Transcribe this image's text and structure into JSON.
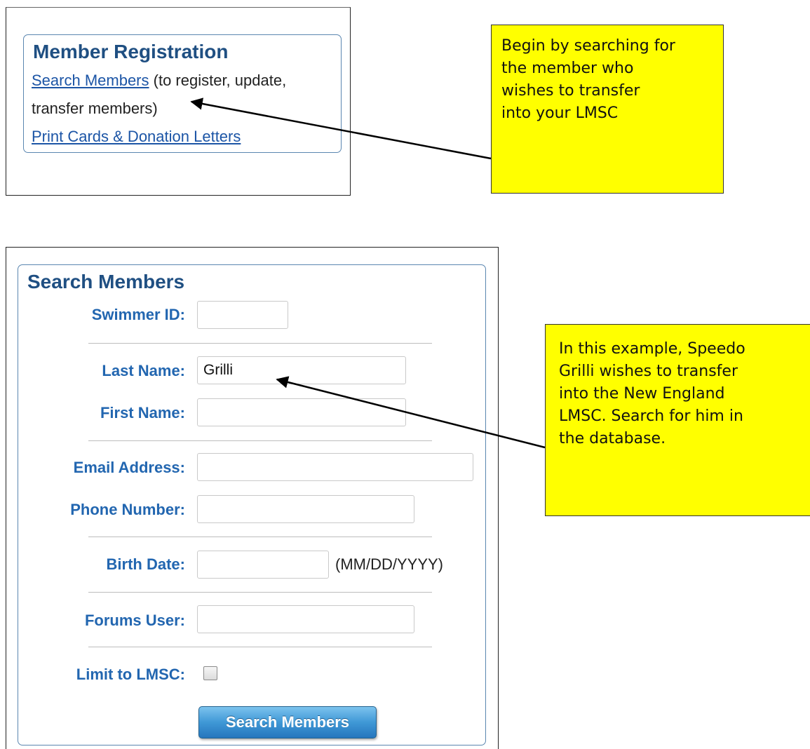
{
  "member_registration": {
    "title": "Member Registration",
    "search_link": "Search Members",
    "search_suffix_1": " (to register, update,",
    "search_suffix_2": "transfer members)",
    "print_link": "Print Cards & Donation Letters"
  },
  "search_form": {
    "title": "Search Members",
    "swimmer_id": {
      "label": "Swimmer ID:",
      "value": ""
    },
    "last_name": {
      "label": "Last Name:",
      "value": "Grilli"
    },
    "first_name": {
      "label": "First Name:",
      "value": ""
    },
    "email": {
      "label": "Email Address:",
      "value": ""
    },
    "phone": {
      "label": "Phone Number:",
      "value": ""
    },
    "birth_date": {
      "label": "Birth Date:",
      "value": "",
      "hint": "(MM/DD/YYYY)"
    },
    "forums_user": {
      "label": "Forums User:",
      "value": ""
    },
    "limit_lmsc": {
      "label": "Limit to LMSC:",
      "checked": false
    },
    "submit_label": "Search Members"
  },
  "callouts": {
    "note1": [
      "Begin by searching for",
      "the member who",
      "wishes to transfer",
      "into your LMSC"
    ],
    "note2": [
      "In this example, Speedo",
      "Grilli wishes to transfer",
      "into the New England",
      "LMSC. Search for him in",
      "the database."
    ]
  },
  "colors": {
    "callout_bg": "#ffff00",
    "label_blue": "#2266b0",
    "title_blue": "#1f4f82",
    "link_blue": "#1c55a6",
    "button_blue": "#3f98d6"
  }
}
